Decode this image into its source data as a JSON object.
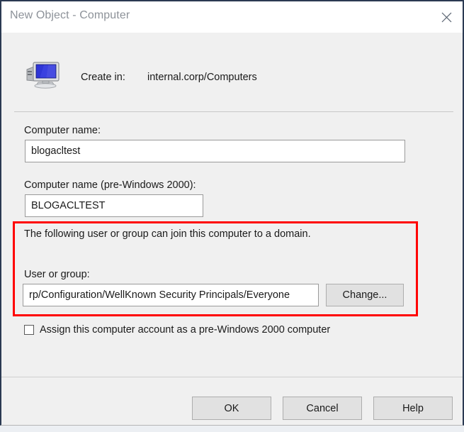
{
  "window": {
    "title": "New Object - Computer",
    "close_icon": "close-icon"
  },
  "header": {
    "icon": "computer-monitor-icon",
    "create_in_label": "Create in:",
    "create_in_value": "internal.corp/Computers"
  },
  "form": {
    "computer_name_label": "Computer name:",
    "computer_name_value": "blogacltest",
    "pre_windows_2000_label": "Computer name (pre-Windows 2000):",
    "pre_windows_2000_value": "BLOGACLTEST"
  },
  "domain_join": {
    "note": "The following user or group can join this computer to a domain.",
    "user_or_group_label": "User or group:",
    "user_or_group_value": "rp/Configuration/WellKnown Security Principals/Everyone",
    "change_button_label": "Change...",
    "highlight_color": "#ff0000"
  },
  "options": {
    "assign_pre_windows_2000_label": "Assign this computer account as a pre-Windows 2000 computer",
    "assign_pre_windows_2000_checked": false
  },
  "footer": {
    "ok_label": "OK",
    "cancel_label": "Cancel",
    "help_label": "Help"
  }
}
